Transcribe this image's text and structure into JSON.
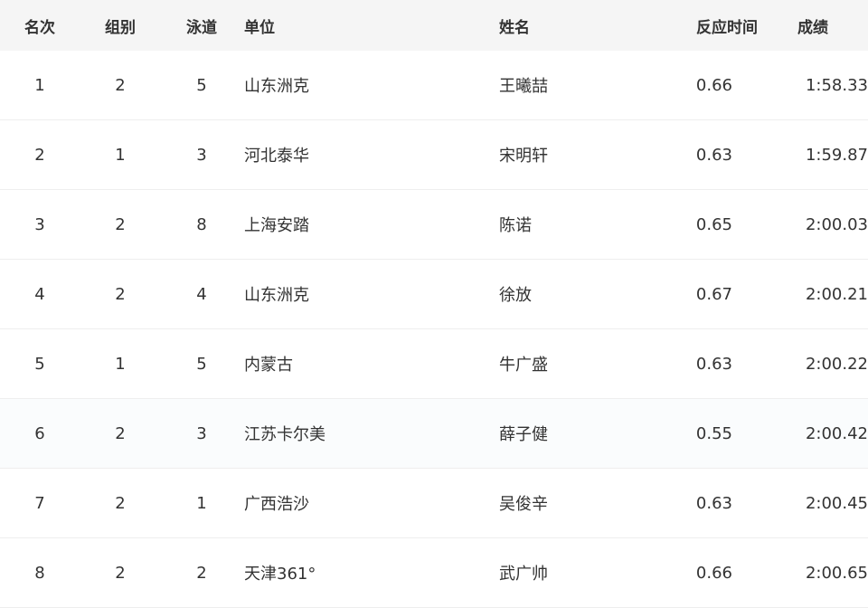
{
  "table": {
    "headers": {
      "rank": "名次",
      "group": "组别",
      "lane": "泳道",
      "unit": "单位",
      "name": "姓名",
      "reaction": "反应时间",
      "result": "成绩"
    },
    "rows": [
      {
        "rank": "1",
        "group": "2",
        "lane": "5",
        "unit": "山东洲克",
        "name": "王曦喆",
        "reaction": "0.66",
        "result": "1:58.33"
      },
      {
        "rank": "2",
        "group": "1",
        "lane": "3",
        "unit": "河北泰华",
        "name": "宋明轩",
        "reaction": "0.63",
        "result": "1:59.87"
      },
      {
        "rank": "3",
        "group": "2",
        "lane": "8",
        "unit": "上海安踏",
        "name": "陈诺",
        "reaction": "0.65",
        "result": "2:00.03"
      },
      {
        "rank": "4",
        "group": "2",
        "lane": "4",
        "unit": "山东洲克",
        "name": "徐放",
        "reaction": "0.67",
        "result": "2:00.21"
      },
      {
        "rank": "5",
        "group": "1",
        "lane": "5",
        "unit": "内蒙古",
        "name": "牛广盛",
        "reaction": "0.63",
        "result": "2:00.22"
      },
      {
        "rank": "6",
        "group": "2",
        "lane": "3",
        "unit": "江苏卡尔美",
        "name": "薛子健",
        "reaction": "0.55",
        "result": "2:00.42"
      },
      {
        "rank": "7",
        "group": "2",
        "lane": "1",
        "unit": "广西浩沙",
        "name": "吴俊辛",
        "reaction": "0.63",
        "result": "2:00.45"
      },
      {
        "rank": "8",
        "group": "2",
        "lane": "2",
        "unit": "天津361°",
        "name": "武广帅",
        "reaction": "0.66",
        "result": "2:00.65"
      }
    ]
  },
  "colors": {
    "header_bg": "#f5f5f5",
    "text": "#333333",
    "row_divider": "#eeeeee",
    "highlight_row_bg": "#fafcfd"
  }
}
